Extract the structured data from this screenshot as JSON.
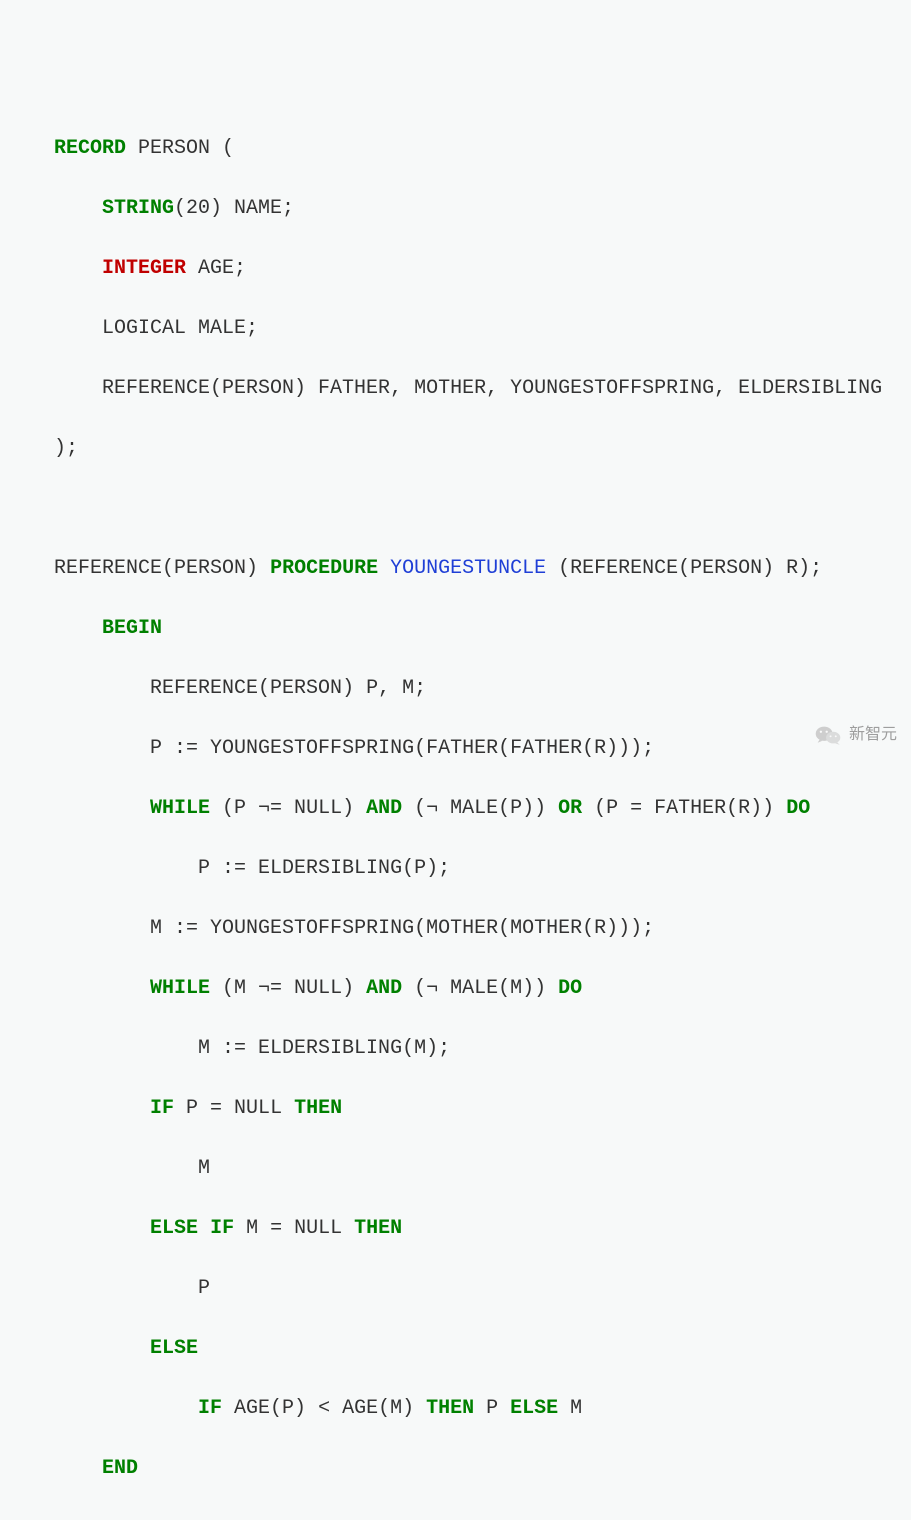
{
  "code": {
    "l1": {
      "record": "RECORD",
      "tail": " PERSON ("
    },
    "l2": {
      "string": "STRING",
      "tail": "(20) NAME;"
    },
    "l3": {
      "integer": "INTEGER",
      "tail": " AGE;"
    },
    "l4": "LOGICAL MALE;",
    "l5": "REFERENCE(PERSON) FATHER, MOTHER, YOUNGESTOFFSPRING, ELDERSIBLING",
    "l6": ");",
    "l8": {
      "pre": "REFERENCE(PERSON) ",
      "procedure": "PROCEDURE",
      "sp": " ",
      "fn": "YOUNGESTUNCLE",
      "post": " (REFERENCE(PERSON) R);"
    },
    "l9": {
      "begin": "BEGIN"
    },
    "l10": "REFERENCE(PERSON) P, M;",
    "l11": "P := YOUNGESTOFFSPRING(FATHER(FATHER(R)));",
    "l12": {
      "while": "WHILE",
      "a": " (P ¬= NULL) ",
      "and": "AND",
      "b": " (¬ MALE(P)) ",
      "or": "OR",
      "c": " (P = FATHER(R)) ",
      "do": "DO"
    },
    "l13": "P := ELDERSIBLING(P);",
    "l14": "M := YOUNGESTOFFSPRING(MOTHER(MOTHER(R)));",
    "l15": {
      "while": "WHILE",
      "a": " (M ¬= NULL) ",
      "and": "AND",
      "b": " (¬ MALE(M)) ",
      "do": "DO"
    },
    "l16": "M := ELDERSIBLING(M);",
    "l17": {
      "if": "IF",
      "cond": " P = NULL ",
      "then": "THEN"
    },
    "l18": "M",
    "l19": {
      "else": "ELSE",
      "sp": " ",
      "if": "IF",
      "cond": " M = NULL ",
      "then": "THEN"
    },
    "l20": "P",
    "l21": {
      "else": "ELSE"
    },
    "l22": {
      "if": "IF",
      "cond": " AGE(P) < AGE(M) ",
      "then": "THEN",
      "a": " P ",
      "else": "ELSE",
      "b": " M"
    },
    "l23": {
      "end": "END"
    }
  },
  "attribution": {
    "label": "新智元",
    "icon_name": "wechat-icon"
  }
}
